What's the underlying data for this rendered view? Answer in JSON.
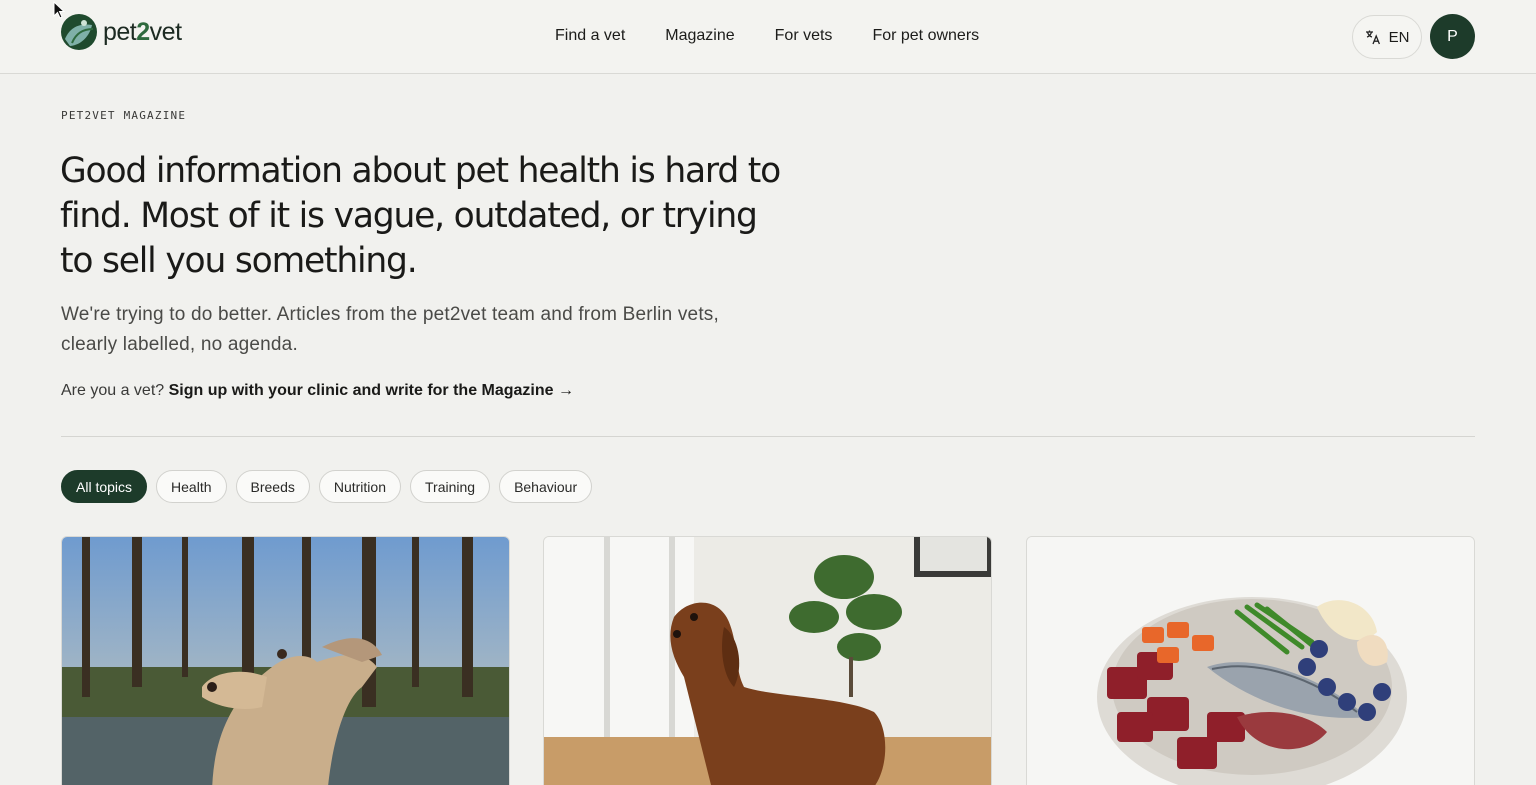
{
  "header": {
    "logo": {
      "prefix": "pet",
      "accent": "2",
      "suffix": "vet"
    },
    "nav": [
      "Find a vet",
      "Magazine",
      "For vets",
      "For pet owners"
    ],
    "language": "EN",
    "avatar_initial": "P"
  },
  "hero": {
    "eyebrow": "PET2VET MAGAZINE",
    "headline": "Good information about pet health is hard to find. Most of it is vague, outdated, or trying to sell you something.",
    "intro": "We're trying to do better. Articles from the pet2vet team and from Berlin vets, clearly labelled, no agenda.",
    "vet_question": "Are you a vet?",
    "vet_link": "Sign up with your clinic and write for the Magazine →"
  },
  "filters": [
    "All topics",
    "Health",
    "Breeds",
    "Nutrition",
    "Training",
    "Behaviour"
  ],
  "active_filter": "All topics",
  "cards": [
    {
      "image": "whippet-in-forest-photo"
    },
    {
      "image": "dachshund-indoors-photo"
    },
    {
      "image": "raw-food-bowl-photo"
    }
  ],
  "colors": {
    "brand_dark": "#1d3b2a",
    "background": "#f1f1ee"
  }
}
